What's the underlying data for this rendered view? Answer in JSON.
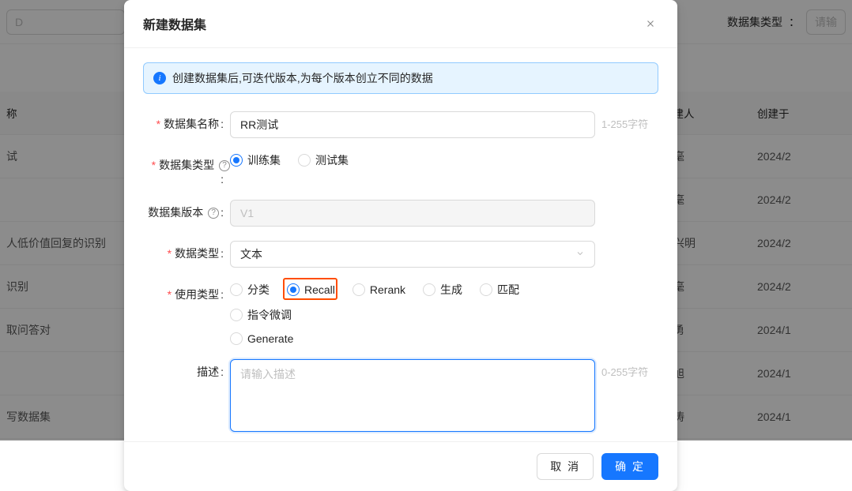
{
  "background": {
    "d_placeholder": "D",
    "filter_label": "数据集类型",
    "filter_placeholder": "请输",
    "columns": {
      "name": "称",
      "creator": "创建人",
      "created_at": "创建于"
    },
    "rows": [
      {
        "name": "试",
        "creator": "陈毫",
        "created_at": "2024/2"
      },
      {
        "name": "",
        "creator": "陈毫",
        "created_at": "2024/2"
      },
      {
        "name": "人低价值回复的识别",
        "creator": "岳兴明",
        "created_at": "2024/2"
      },
      {
        "name": "识别",
        "creator": "陈毫",
        "created_at": "2024/2"
      },
      {
        "name": "取问答对",
        "creator": "李勇",
        "created_at": "2024/1"
      },
      {
        "name": "",
        "creator": "严旭",
        "created_at": "2024/1"
      },
      {
        "name": "写数据集",
        "creator": "郭涛",
        "created_at": "2024/1"
      }
    ]
  },
  "modal": {
    "title": "新建数据集",
    "alert": "创建数据集后,可迭代版本,为每个版本创立不同的数据",
    "labels": {
      "name": "数据集名称",
      "dataset_type": "数据集类型",
      "version": "数据集版本",
      "data_type": "数据类型",
      "use_type": "使用类型",
      "description": "描述"
    },
    "name_value": "RR测试",
    "name_hint": "1-255字符",
    "dataset_type_options": {
      "train": "训练集",
      "test": "测试集"
    },
    "version_value": "V1",
    "data_type_value": "文本",
    "use_type_options": {
      "classify": "分类",
      "recall": "Recall",
      "rerank": "Rerank",
      "generate_cn": "生成",
      "match": "匹配",
      "instruct": "指令微调",
      "generate_en": "Generate"
    },
    "description_placeholder": "请输入描述",
    "description_hint": "0-255字符",
    "buttons": {
      "cancel": "取 消",
      "ok": "确 定"
    }
  }
}
